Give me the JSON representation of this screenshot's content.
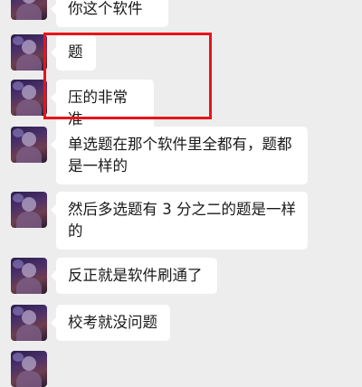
{
  "chat": {
    "messages": [
      {
        "text": "你这个软件"
      },
      {
        "text": "题"
      },
      {
        "text": "压的非常准"
      },
      {
        "text": "单选题在那个软件里全都有，题都\n是一样的"
      },
      {
        "text": "然后多选题有 3 分之二的题是一样\n的"
      },
      {
        "text": "反正就是软件刷通了"
      },
      {
        "text": "校考就没问题"
      }
    ]
  },
  "colors": {
    "background": "#ededed",
    "bubble": "#ffffff",
    "text": "#191919",
    "highlight": "#e8141b"
  }
}
